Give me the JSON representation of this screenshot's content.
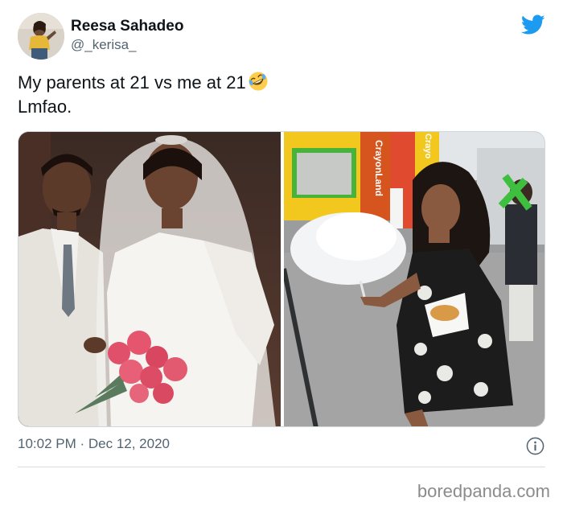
{
  "author": {
    "display_name": "Reesa Sahadeo",
    "handle": "@_kerisa_"
  },
  "tweet": {
    "text_line1": "My parents at 21 vs me at 21",
    "text_line2": "Lmfao.",
    "emoji": "rolling-on-floor-laughing-emoji"
  },
  "media": {
    "photos": [
      {
        "subject": "wedding-photo"
      },
      {
        "subject": "cotton-candy-photo"
      }
    ],
    "sign_text_1": "CrayonLand",
    "sign_text_2": "Crayo"
  },
  "footer": {
    "timestamp": "10:02 PM · Dec 12, 2020"
  },
  "watermark": "boredpanda.com",
  "colors": {
    "twitter_blue": "#1d9bf0",
    "secondary_text": "#536471",
    "primary_text": "#0f1419"
  }
}
